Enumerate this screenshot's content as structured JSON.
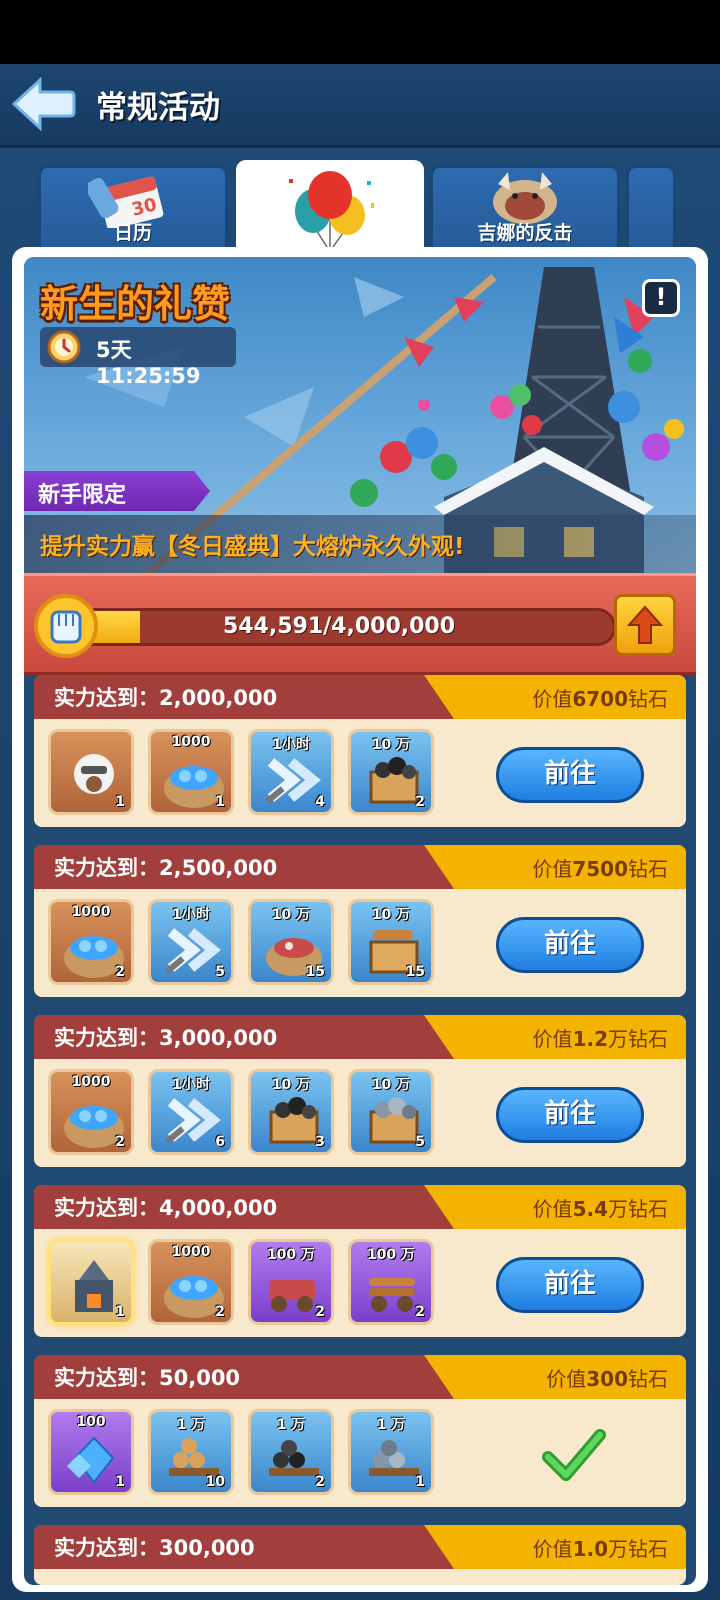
{
  "header": {
    "title": "常规活动"
  },
  "tabs": [
    {
      "label": "日历",
      "calendar_day": "30"
    },
    {
      "label": ""
    },
    {
      "label": "吉娜的反击"
    }
  ],
  "event": {
    "title": "新生的礼赞",
    "info_icon": "!",
    "timer": "5天 11:25:59",
    "ribbon": "新手限定",
    "subtitle": "提升实力赢【冬日盛典】大熔炉永久外观!"
  },
  "progress": {
    "current": 544591,
    "target": 4000000,
    "text": "544,591/4,000,000"
  },
  "rows": [
    {
      "req_label": "实力达到：",
      "req": "2,000,000",
      "value_prefix": "价值",
      "value": "6700",
      "value_suffix": "钻石",
      "items": [
        {
          "icon": "hero-portrait-icon",
          "top": "",
          "qty": "1"
        },
        {
          "icon": "diamond-bag-icon",
          "top": "1000",
          "qty": "1"
        },
        {
          "icon": "speedup-icon",
          "top": "1小时",
          "qty": "4"
        },
        {
          "icon": "coal-crate-icon",
          "top": "10 万",
          "qty": "2"
        }
      ],
      "action": "前往"
    },
    {
      "req_label": "实力达到：",
      "req": "2,500,000",
      "value_prefix": "价值",
      "value": "7500",
      "value_suffix": "钻石",
      "items": [
        {
          "icon": "diamond-bag-icon",
          "top": "1000",
          "qty": "2"
        },
        {
          "icon": "speedup-icon",
          "top": "1小时",
          "qty": "5"
        },
        {
          "icon": "meat-sack-icon",
          "top": "10 万",
          "qty": "15"
        },
        {
          "icon": "wood-crate-icon",
          "top": "10 万",
          "qty": "15"
        }
      ],
      "action": "前往"
    },
    {
      "req_label": "实力达到：",
      "req": "3,000,000",
      "value_prefix": "价值",
      "value": "1.2",
      "value_suffix": "万钻石",
      "items": [
        {
          "icon": "diamond-bag-icon",
          "top": "1000",
          "qty": "2"
        },
        {
          "icon": "speedup-icon",
          "top": "1小时",
          "qty": "6"
        },
        {
          "icon": "coal-crate-icon",
          "top": "10 万",
          "qty": "3"
        },
        {
          "icon": "iron-crate-icon",
          "top": "10 万",
          "qty": "5"
        }
      ],
      "action": "前往"
    },
    {
      "req_label": "实力达到：",
      "req": "4,000,000",
      "value_prefix": "价值",
      "value": "5.4",
      "value_suffix": "万钻石",
      "items": [
        {
          "icon": "furnace-skin-icon",
          "top": "",
          "qty": "1"
        },
        {
          "icon": "diamond-bag-icon",
          "top": "1000",
          "qty": "2"
        },
        {
          "icon": "meat-cart-icon",
          "top": "100 万",
          "qty": "2"
        },
        {
          "icon": "wood-cart-icon",
          "top": "100 万",
          "qty": "2"
        }
      ],
      "action": "前往"
    },
    {
      "req_label": "实力达到：",
      "req": "50,000",
      "value_prefix": "价值",
      "value": "300",
      "value_suffix": "钻石",
      "items": [
        {
          "icon": "diamond-pile-icon",
          "top": "100",
          "qty": "1"
        },
        {
          "icon": "wood-pile-icon",
          "top": "1 万",
          "qty": "10"
        },
        {
          "icon": "coal-pile-icon",
          "top": "1 万",
          "qty": "2"
        },
        {
          "icon": "iron-pile-icon",
          "top": "1 万",
          "qty": "1"
        }
      ],
      "action": "",
      "claimed": true
    },
    {
      "req_label": "实力达到：",
      "req": "300,000",
      "value_prefix": "价值",
      "value": "1.0",
      "value_suffix": "万钻石",
      "items": [],
      "action": ""
    }
  ]
}
